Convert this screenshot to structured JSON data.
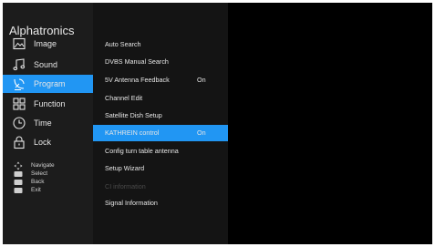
{
  "app": {
    "title": "Alphatronics"
  },
  "sidebar": {
    "items": [
      {
        "label": "Image",
        "icon": "image-icon"
      },
      {
        "label": "Sound",
        "icon": "music-note-icon"
      },
      {
        "label": "Program",
        "icon": "satellite-dish-icon",
        "active": true
      },
      {
        "label": "Function",
        "icon": "grid-icon"
      },
      {
        "label": "Time",
        "icon": "clock-icon"
      },
      {
        "label": "Lock",
        "icon": "lock-icon"
      }
    ]
  },
  "help": {
    "items": [
      {
        "label": "Navigate",
        "icon": "dpad-icon"
      },
      {
        "label": "Select",
        "icon": "ok-key-icon"
      },
      {
        "label": "Back",
        "icon": "back-key-icon"
      },
      {
        "label": "Exit",
        "icon": "exit-key-icon"
      }
    ]
  },
  "menu": {
    "items": [
      {
        "label": "Auto Search",
        "value": ""
      },
      {
        "label": "DVBS Manual Search",
        "value": ""
      },
      {
        "label": "5V Antenna Feedback",
        "value": "On"
      },
      {
        "label": "Channel Edit",
        "value": ""
      },
      {
        "label": "Satellite Dish Setup",
        "value": ""
      },
      {
        "label": "KATHREIN control",
        "value": "On",
        "active": true
      },
      {
        "label": "Config turn table antenna",
        "value": ""
      },
      {
        "label": "Setup Wizard",
        "value": ""
      },
      {
        "label": "CI information",
        "value": "",
        "disabled": true
      },
      {
        "label": "Signal Information",
        "value": ""
      }
    ]
  },
  "colors": {
    "accent": "#2196f3",
    "sidebar_bg": "#1c1c1c",
    "menu_bg": "#141414",
    "screen_bg": "#000000",
    "text": "#e6e6e6",
    "disabled_text": "#4a4a4a"
  }
}
